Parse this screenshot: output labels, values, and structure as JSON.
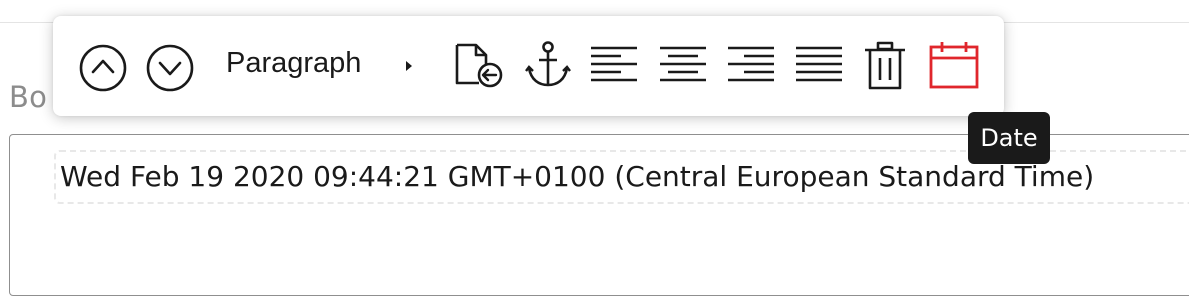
{
  "field": {
    "label": "Bo"
  },
  "toolbar": {
    "paragraph_label": "Paragraph",
    "accent_color": "#e0262c",
    "icons": [
      "chevron-up-circle-icon",
      "chevron-down-circle-icon",
      "caret-right-icon",
      "file-return-icon",
      "anchor-icon",
      "align-left-icon",
      "align-center-icon",
      "align-right-icon",
      "align-justify-icon",
      "trash-icon",
      "calendar-icon"
    ]
  },
  "tooltip": {
    "text": "Date"
  },
  "editor": {
    "content": "Wed Feb 19 2020 09:44:21 GMT+0100 (Central European Standard Time)"
  }
}
